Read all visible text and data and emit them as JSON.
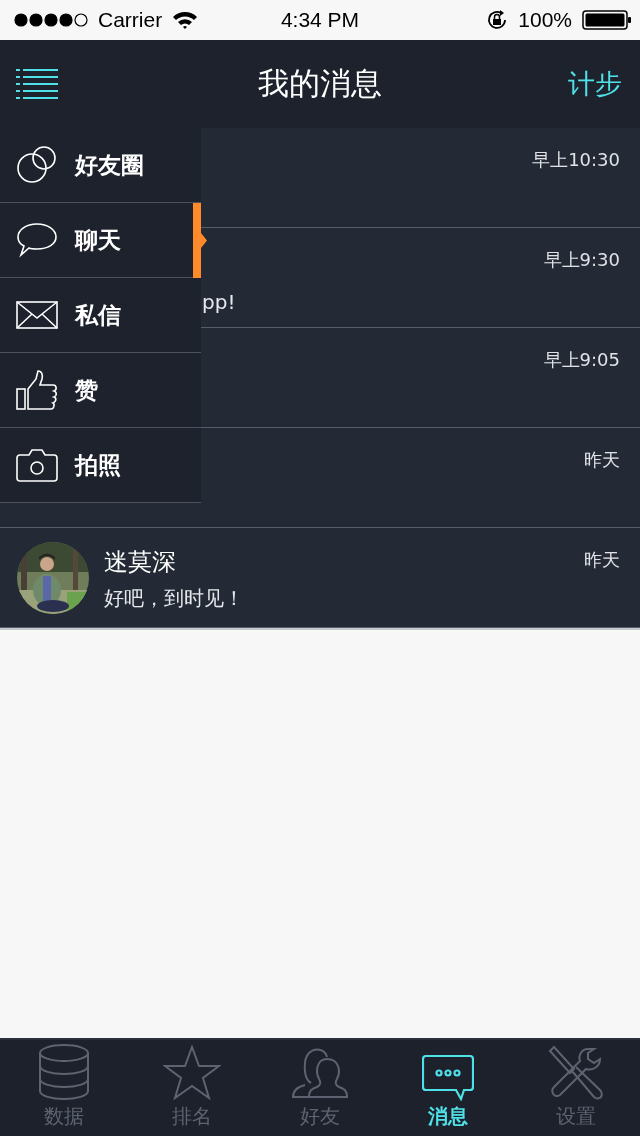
{
  "status_bar": {
    "carrier": "Carrier",
    "time": "4:34 PM",
    "battery": "100%"
  },
  "nav": {
    "title": "我的消息",
    "action": "计步"
  },
  "messages": [
    {
      "time": "早上10:30"
    },
    {
      "time": "早上9:30",
      "preview": "pp!"
    },
    {
      "time": "早上9:05"
    },
    {
      "time": "昨天"
    },
    {
      "name": "迷莫深",
      "preview": "好吧，到时见！",
      "time": "昨天"
    }
  ],
  "menu": [
    {
      "label": "好友圈",
      "selected": false
    },
    {
      "label": "聊天",
      "selected": true
    },
    {
      "label": "私信",
      "selected": false
    },
    {
      "label": "赞",
      "selected": false
    },
    {
      "label": "拍照",
      "selected": false
    }
  ],
  "tabs": [
    {
      "label": "数据",
      "selected": false
    },
    {
      "label": "排名",
      "selected": false
    },
    {
      "label": "好友",
      "selected": false
    },
    {
      "label": "消息",
      "selected": true
    },
    {
      "label": "设置",
      "selected": false
    }
  ]
}
